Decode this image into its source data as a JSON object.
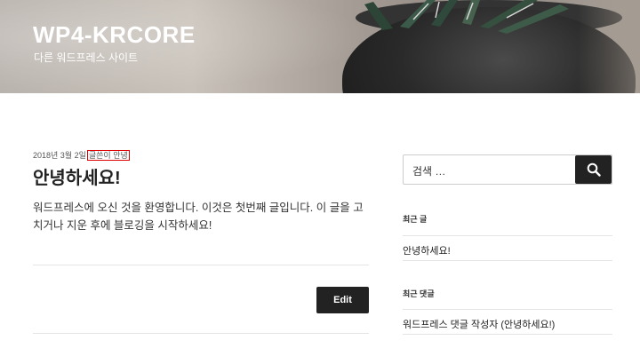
{
  "header": {
    "site_title": "WP4-KRCORE",
    "site_description": "다른 워드프레스 사이트"
  },
  "post": {
    "date": "2018년 3월 2일",
    "category": "글쓴이 안녕",
    "title": "안녕하세요!",
    "content": "워드프레스에 오신 것을 환영합니다. 이것은 첫번째 글입니다. 이 글을 고치거나 지운 후에 블로깅을 시작하세요!",
    "edit_label": "Edit"
  },
  "sidebar": {
    "search_placeholder": "검색 …",
    "recent_posts_title": "최근 글",
    "recent_posts": [
      "안녕하세요!"
    ],
    "recent_comments_title": "최근 댓글",
    "recent_comments": [
      "워드프레스 댓글 작성자 (안녕하세요!)"
    ]
  },
  "colors": {
    "button_bg": "#222222",
    "category_border": "#dd0000"
  }
}
